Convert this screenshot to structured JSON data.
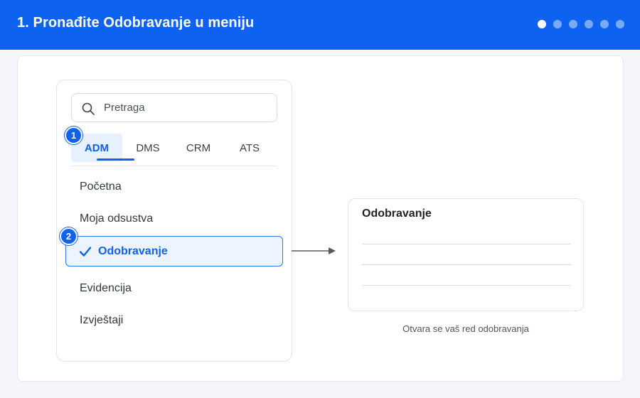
{
  "header": {
    "title": "1. Pronađite Odobravanje u meniju",
    "step_dots": [
      true,
      false,
      false,
      false,
      false,
      false
    ]
  },
  "menu": {
    "search_placeholder": "Pretraga",
    "tabs": [
      {
        "label": "ADM",
        "active": true
      },
      {
        "label": "DMS",
        "active": false
      },
      {
        "label": "CRM",
        "active": false
      },
      {
        "label": "ATS",
        "active": false
      }
    ],
    "items": [
      {
        "label": "Početna",
        "selected": false
      },
      {
        "label": "Moja odsustva",
        "selected": false
      },
      {
        "label": "Odobravanje",
        "selected": true
      },
      {
        "label": "Evidencija",
        "selected": false
      },
      {
        "label": "Izvještaji",
        "selected": false
      }
    ],
    "badges": [
      "1",
      "2"
    ]
  },
  "card": {
    "title": "Odobravanje",
    "caption": "Otvara se vaš red odobravanja"
  },
  "colors": {
    "accent": "#0d63f0",
    "selected_bg": "#edf4ff"
  }
}
